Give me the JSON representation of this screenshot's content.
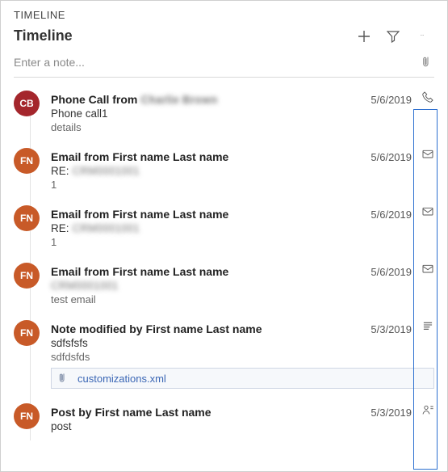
{
  "section_label": "TIMELINE",
  "header": {
    "title": "Timeline"
  },
  "note": {
    "placeholder": "Enter a note..."
  },
  "items": [
    {
      "avatar": {
        "initials": "CB",
        "cls": "cb"
      },
      "title_prefix": "Phone Call from ",
      "title_name": "Charlie Brown",
      "name_blurred": true,
      "date": "5/6/2019",
      "type": "phone",
      "subject_prefix": "Phone call1",
      "subject_rest": "",
      "subject_blurred": false,
      "details": "details",
      "attachment": null
    },
    {
      "avatar": {
        "initials": "FN",
        "cls": "fn"
      },
      "title_prefix": "Email from ",
      "title_name": "First name Last name",
      "name_blurred": false,
      "date": "5/6/2019",
      "type": "email",
      "subject_prefix": "RE: ",
      "subject_rest": "CRM0001001",
      "subject_blurred": true,
      "details": "1",
      "attachment": null
    },
    {
      "avatar": {
        "initials": "FN",
        "cls": "fn"
      },
      "title_prefix": "Email from ",
      "title_name": "First name Last name",
      "name_blurred": false,
      "date": "5/6/2019",
      "type": "email",
      "subject_prefix": "RE: ",
      "subject_rest": "CRM0001001",
      "subject_blurred": true,
      "details": "1",
      "attachment": null
    },
    {
      "avatar": {
        "initials": "FN",
        "cls": "fn"
      },
      "title_prefix": "Email from ",
      "title_name": "First name Last name",
      "name_blurred": false,
      "date": "5/6/2019",
      "type": "email",
      "subject_prefix": "",
      "subject_rest": "CRM0001001",
      "subject_blurred": true,
      "details": "test email",
      "attachment": null
    },
    {
      "avatar": {
        "initials": "FN",
        "cls": "fn"
      },
      "title_prefix": "Note modified by ",
      "title_name": "First name Last name",
      "name_blurred": false,
      "date": "5/3/2019",
      "type": "note",
      "subject_prefix": "sdfsfsfs",
      "subject_rest": "",
      "subject_blurred": false,
      "details": "sdfdsfds",
      "attachment": "customizations.xml"
    },
    {
      "avatar": {
        "initials": "FN",
        "cls": "fn"
      },
      "title_prefix": "Post by ",
      "title_name": "First name Last name",
      "name_blurred": false,
      "date": "5/3/2019",
      "type": "post",
      "subject_prefix": "post",
      "subject_rest": "",
      "subject_blurred": false,
      "details": "",
      "attachment": null
    }
  ]
}
